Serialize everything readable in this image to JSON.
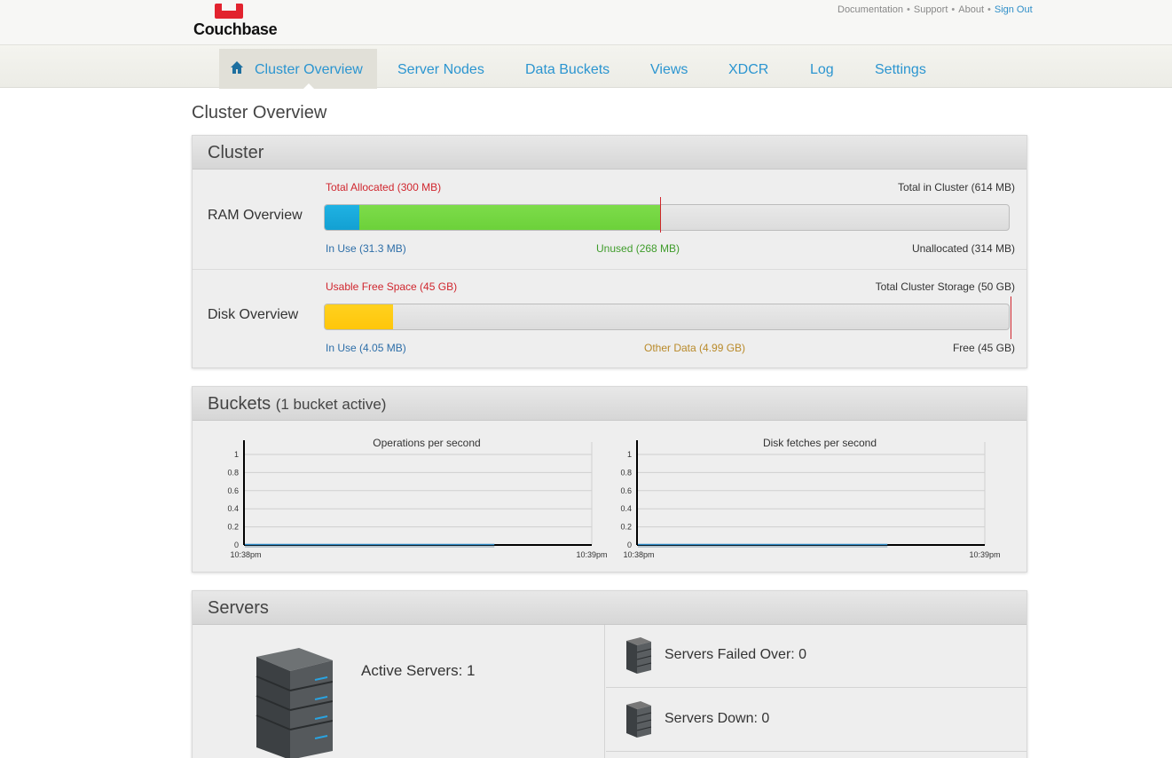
{
  "brand": {
    "name": "Couchbase",
    "logo_color": "#e2232e"
  },
  "toplinks": {
    "documentation": "Documentation",
    "support": "Support",
    "about": "About",
    "sign_out": "Sign Out",
    "separator": "•"
  },
  "nav": {
    "items": [
      {
        "label": "Cluster Overview",
        "icon": "home-icon",
        "active": true
      },
      {
        "label": "Server Nodes"
      },
      {
        "label": "Data Buckets"
      },
      {
        "label": "Views"
      },
      {
        "label": "XDCR"
      },
      {
        "label": "Log"
      },
      {
        "label": "Settings"
      }
    ]
  },
  "page_title": "Cluster Overview",
  "cluster": {
    "title": "Cluster",
    "ram": {
      "label": "RAM Overview",
      "total_allocated": "Total Allocated (300 MB)",
      "total_in_cluster": "Total in Cluster (614 MB)",
      "in_use": "In Use (31.3 MB)",
      "unused": "Unused (268 MB)",
      "unallocated": "Unallocated (314 MB)",
      "in_use_mb": 31.3,
      "unused_mb": 268,
      "allocated_mb": 300,
      "total_mb": 614,
      "colors": {
        "in_use": "#1fb2e3",
        "unused": "#7ddc4a",
        "marker": "#d0262e"
      }
    },
    "disk": {
      "label": "Disk Overview",
      "usable_free": "Usable Free Space (45 GB)",
      "total_storage": "Total Cluster Storage (50 GB)",
      "in_use": "In Use (4.05 MB)",
      "other_data": "Other Data (4.99 GB)",
      "free": "Free (45 GB)",
      "other_gb": 4.99,
      "usable_free_gb": 45,
      "total_gb": 50,
      "colors": {
        "other": "#ffc60a",
        "marker": "#d0262e"
      }
    },
    "label_colors": {
      "red": "#d0262e",
      "blue": "#2d6ea8",
      "green": "#3f9c2b",
      "amber": "#b98a2a",
      "dark": "#333333"
    }
  },
  "buckets": {
    "title": "Buckets",
    "subtitle": "(1 bucket active)",
    "charts": [
      {
        "title": "Operations per second",
        "yticks": [
          "1",
          "0.8",
          "0.6",
          "0.4",
          "0.2",
          "0"
        ],
        "xstart": "10:38pm",
        "xend": "10:39pm",
        "series_end_fraction": 0.72
      },
      {
        "title": "Disk fetches per second",
        "yticks": [
          "1",
          "0.8",
          "0.6",
          "0.4",
          "0.2",
          "0"
        ],
        "xstart": "10:38pm",
        "xend": "10:39pm",
        "series_end_fraction": 0.72
      }
    ]
  },
  "chart_data": [
    {
      "type": "line",
      "title": "Operations per second",
      "x": [
        "10:38pm",
        "10:39pm"
      ],
      "ylim": [
        0,
        1
      ],
      "series": [
        {
          "values": [
            0,
            0
          ]
        }
      ]
    },
    {
      "type": "line",
      "title": "Disk fetches per second",
      "x": [
        "10:38pm",
        "10:39pm"
      ],
      "ylim": [
        0,
        1
      ],
      "series": [
        {
          "values": [
            0,
            0
          ]
        }
      ]
    }
  ],
  "servers": {
    "title": "Servers",
    "active": "Active Servers: 1",
    "failed_over": "Servers Failed Over: 0",
    "down": "Servers Down: 0"
  }
}
